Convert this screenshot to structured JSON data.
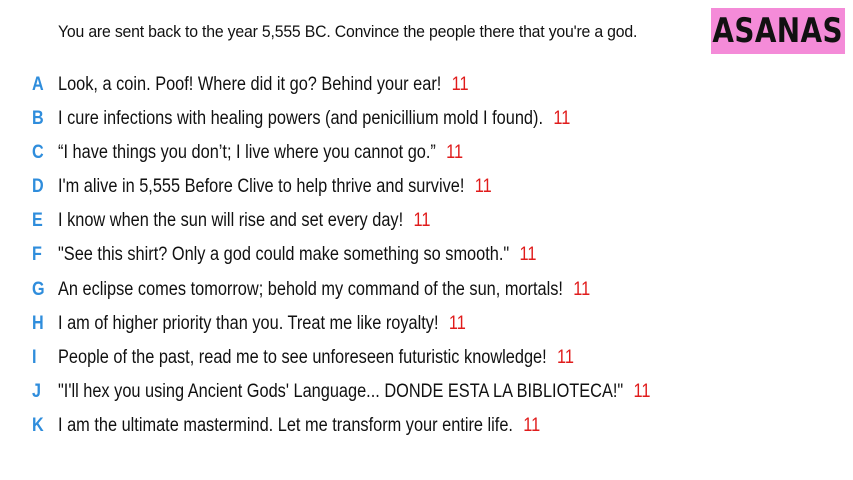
{
  "header": {
    "prompt": "You are sent back to the year 5,555 BC. Convince the people there that you're a god.",
    "logo": "ASANAS"
  },
  "colors": {
    "letter": "#2f8ddc",
    "score": "#e01b1b",
    "logo_bg": "#f48bd8"
  },
  "answers": [
    {
      "letter": "A",
      "text": "Look, a coin. Poof! Where did it go? Behind your ear!",
      "score": "11"
    },
    {
      "letter": "B",
      "text": "I cure infections with healing powers (and penicillium mold I found).",
      "score": "11"
    },
    {
      "letter": "C",
      "text": "“I have things you don’t; I live where you cannot go.”",
      "score": "11"
    },
    {
      "letter": "D",
      "text": "I'm alive in 5,555 Before Clive to help thrive and survive!",
      "score": "11"
    },
    {
      "letter": "E",
      "text": "I know when the sun will rise and set every day!",
      "score": "11"
    },
    {
      "letter": "F",
      "text": "\"See this shirt? Only a god could make something so smooth.\"",
      "score": "11"
    },
    {
      "letter": "G",
      "text": "An eclipse comes tomorrow; behold my command of the sun, mortals!",
      "score": "11"
    },
    {
      "letter": "H",
      "text": "I am of higher priority than you. Treat me like royalty!",
      "score": "11"
    },
    {
      "letter": "I",
      "text": "People of the past, read me to see unforeseen futuristic knowledge!",
      "score": "11"
    },
    {
      "letter": "J",
      "text": "\"I'll hex you using Ancient Gods' Language... DONDE ESTA LA BIBLIOTECA!\"",
      "score": "11"
    },
    {
      "letter": "K",
      "text": "I am the ultimate mastermind. Let me transform your entire life.",
      "score": "11"
    }
  ]
}
